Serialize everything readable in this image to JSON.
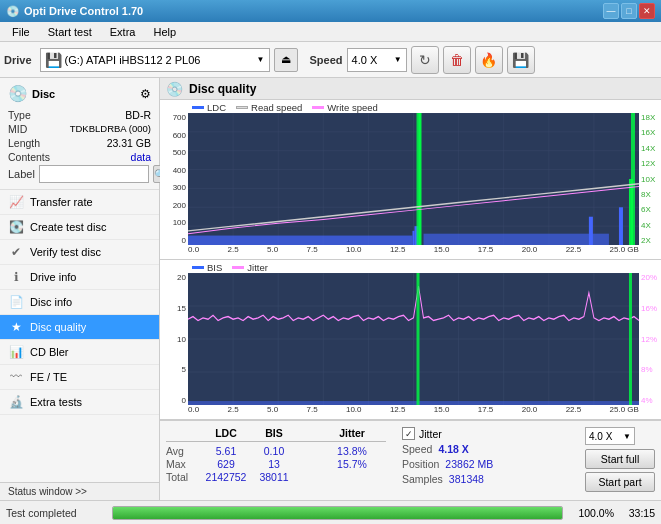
{
  "app": {
    "title": "Opti Drive Control 1.70",
    "icon": "💿"
  },
  "titlebar": {
    "minimize_label": "—",
    "maximize_label": "□",
    "close_label": "✕"
  },
  "menubar": {
    "items": [
      "File",
      "Start test",
      "Extra",
      "Help"
    ]
  },
  "toolbar": {
    "drive_label": "Drive",
    "drive_value": "(G:) ATAPI iHBS112 2 PL06",
    "speed_label": "Speed",
    "speed_value": "4.0 X",
    "eject_label": "⏏"
  },
  "disc": {
    "title": "Disc",
    "type_label": "Type",
    "type_value": "BD-R",
    "mid_label": "MID",
    "mid_value": "TDKBLDRBA (000)",
    "length_label": "Length",
    "length_value": "23.31 GB",
    "contents_label": "Contents",
    "contents_value": "data",
    "label_label": "Label",
    "label_value": ""
  },
  "sidebar": {
    "items": [
      {
        "label": "Transfer rate",
        "icon": "📈"
      },
      {
        "label": "Create test disc",
        "icon": "💽"
      },
      {
        "label": "Verify test disc",
        "icon": "✔"
      },
      {
        "label": "Drive info",
        "icon": "ℹ"
      },
      {
        "label": "Disc info",
        "icon": "📄"
      },
      {
        "label": "Disc quality",
        "icon": "★",
        "active": true
      },
      {
        "label": "CD Bler",
        "icon": "📊"
      },
      {
        "label": "FE / TE",
        "icon": "〰"
      },
      {
        "label": "Extra tests",
        "icon": "🔬"
      }
    ]
  },
  "disc_quality": {
    "title": "Disc quality",
    "chart1": {
      "legend": [
        "LDC",
        "Read speed",
        "Write speed"
      ],
      "y_labels_left": [
        "700",
        "600",
        "500",
        "400",
        "300",
        "200",
        "100",
        "0"
      ],
      "y_labels_right": [
        "18X",
        "16X",
        "14X",
        "12X",
        "10X",
        "8X",
        "6X",
        "4X",
        "2X"
      ],
      "x_labels": [
        "0.0",
        "2.5",
        "5.0",
        "7.5",
        "10.0",
        "12.5",
        "15.0",
        "17.5",
        "20.0",
        "22.5",
        "25.0 GB"
      ]
    },
    "chart2": {
      "legend": [
        "BIS",
        "Jitter"
      ],
      "y_labels_left": [
        "20",
        "15",
        "10",
        "5",
        "0"
      ],
      "y_labels_right": [
        "20%",
        "16%",
        "12%",
        "8%",
        "4%"
      ],
      "x_labels": [
        "0.0",
        "2.5",
        "5.0",
        "7.5",
        "10.0",
        "12.5",
        "15.0",
        "17.5",
        "20.0",
        "22.5",
        "25.0 GB"
      ]
    }
  },
  "stats": {
    "headers": [
      "",
      "LDC",
      "BIS",
      "",
      "Jitter",
      "Speed"
    ],
    "avg_label": "Avg",
    "max_label": "Max",
    "total_label": "Total",
    "ldc_avg": "5.61",
    "ldc_max": "629",
    "ldc_total": "2142752",
    "bis_avg": "0.10",
    "bis_max": "13",
    "bis_total": "38011",
    "jitter_avg": "13.8%",
    "jitter_max": "15.7%",
    "jitter_checked": true,
    "speed_label": "Speed",
    "speed_value": "4.18 X",
    "speed_select": "4.0 X",
    "position_label": "Position",
    "position_value": "23862 MB",
    "samples_label": "Samples",
    "samples_value": "381348"
  },
  "buttons": {
    "start_full": "Start full",
    "start_part": "Start part"
  },
  "statusbar": {
    "status_window_label": "Status window >>",
    "status_text": "Test completed",
    "progress": 100,
    "progress_pct": "100.0%",
    "time": "33:15"
  }
}
